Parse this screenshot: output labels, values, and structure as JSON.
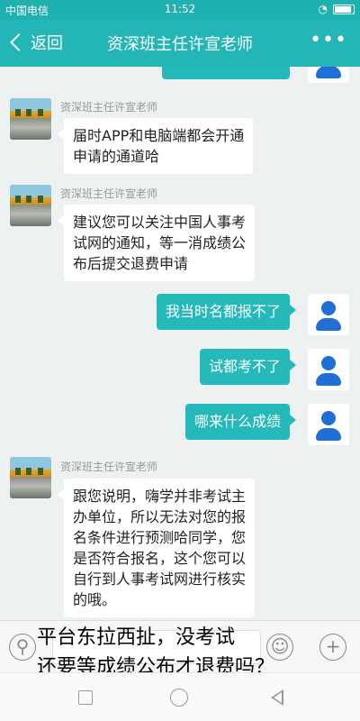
{
  "status_bar": {
    "carrier": "中国电信",
    "time": "11:52"
  },
  "header": {
    "back_label": "返回",
    "title": "资深班主任许宣老师",
    "more_label": "•••"
  },
  "messages": [
    {
      "from": "teacher",
      "sender": "资深班主任许宣老师",
      "lines": [
        "届时APP和电脑端都会开通",
        "申请的通道哈"
      ]
    },
    {
      "from": "teacher",
      "sender": "资深班主任许宣老师",
      "lines": [
        "建议您可以关注中国人事考",
        "试网的通知，等一消成绩公",
        "布后提交退费申请"
      ]
    },
    {
      "from": "user",
      "text": "我当时名都报不了"
    },
    {
      "from": "user",
      "text": "试都考不了"
    },
    {
      "from": "user",
      "text": "哪来什么成绩"
    },
    {
      "from": "teacher",
      "sender": "资深班主任许宣老师",
      "lines": [
        "跟您说明，嗨学并非考试主",
        "办单位，所以无法对您的报",
        "名条件进行预测哈同学，您",
        "是否符合报名，这个您可以",
        "自行到人事考试网进行核实",
        "的哦。"
      ]
    }
  ],
  "caption": {
    "line1": "平台东拉西扯，没考试",
    "line2": "还要等成绩公布才退费吗？"
  }
}
